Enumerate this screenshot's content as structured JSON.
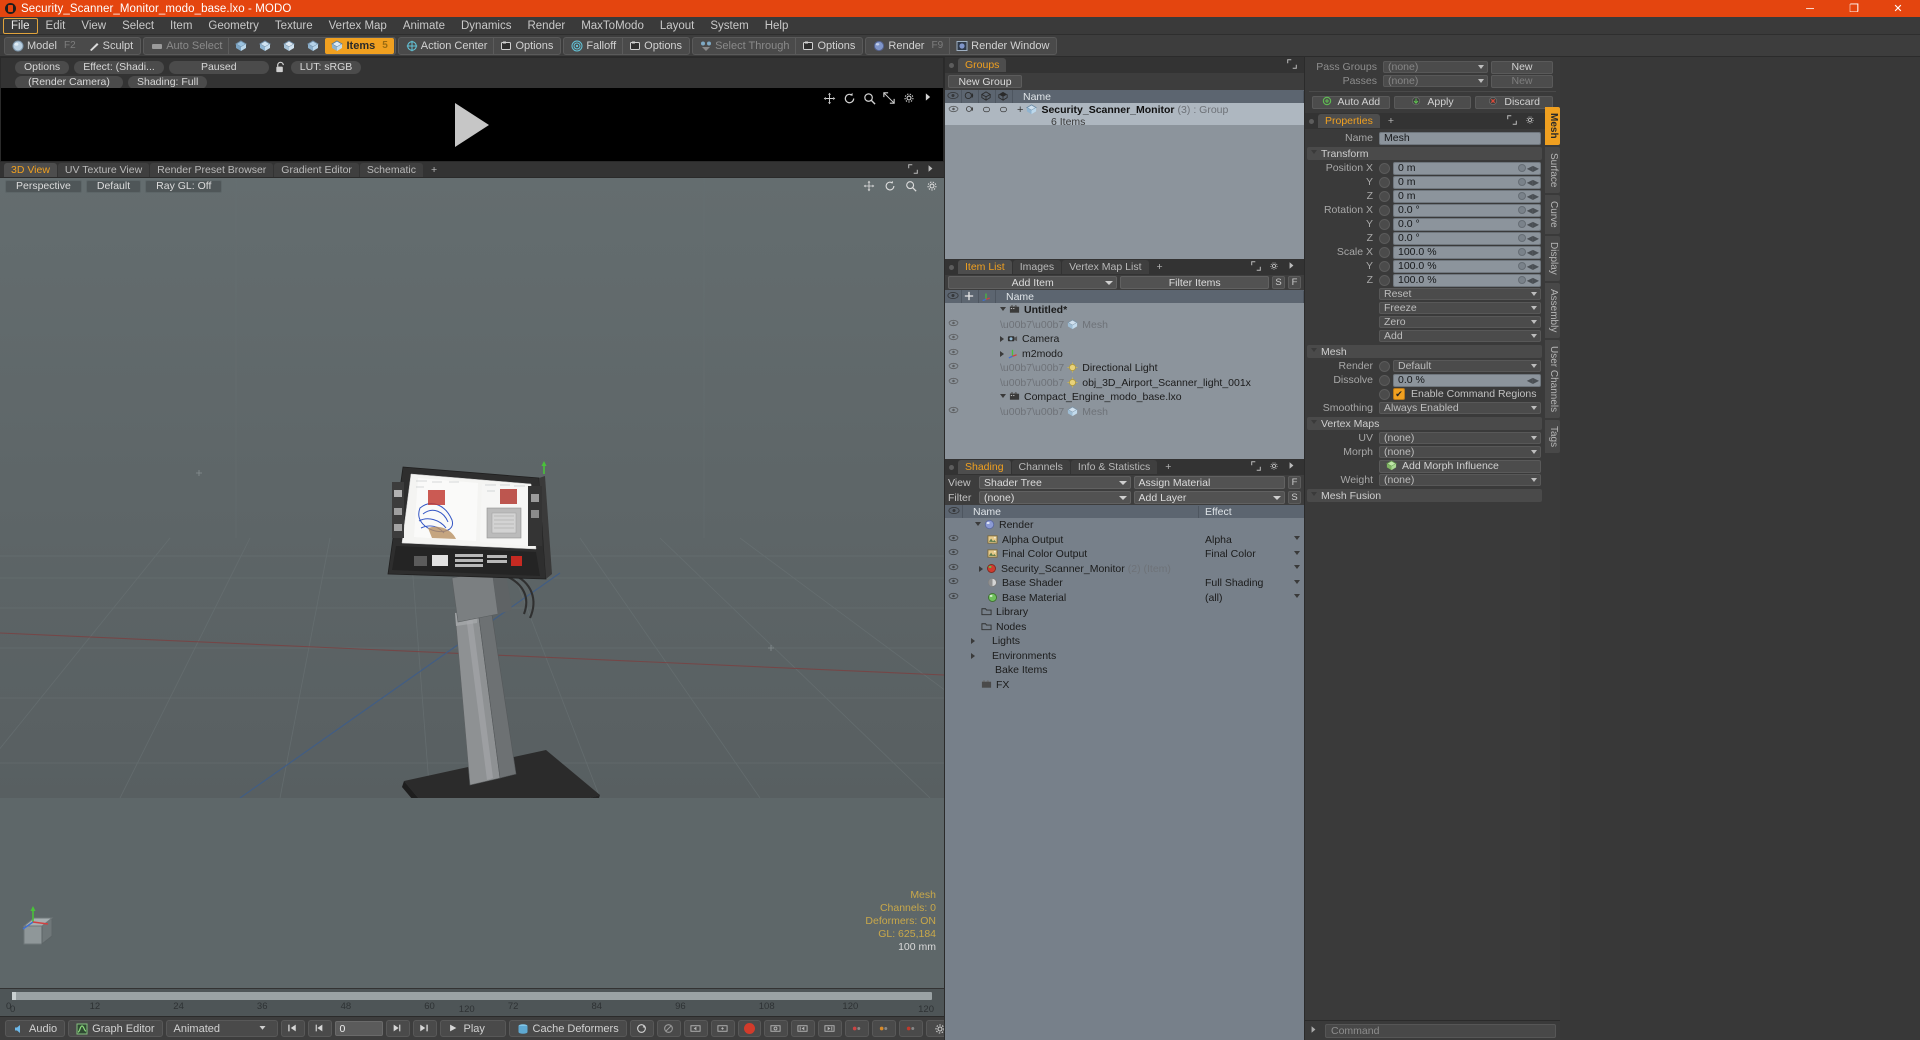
{
  "window": {
    "title": "Security_Scanner_Monitor_modo_base.lxo - MODO",
    "minimize": "─",
    "maximize": "❐",
    "close": "✕"
  },
  "menubar": {
    "items": [
      "File",
      "Edit",
      "View",
      "Select",
      "Item",
      "Geometry",
      "Texture",
      "Vertex Map",
      "Animate",
      "Dynamics",
      "Render",
      "MaxToModo",
      "Layout",
      "System",
      "Help"
    ],
    "active": "File"
  },
  "modebar": {
    "model": "Model",
    "model_key": "F2",
    "sculpt": "Sculpt",
    "auto_select": "Auto Select",
    "items": "Items",
    "items_key": "5",
    "action_center": "Action Center",
    "options1": "Options",
    "falloff": "Falloff",
    "options2": "Options",
    "select_through": "Select Through",
    "options3": "Options",
    "render": "Render",
    "render_key": "F9",
    "render_window": "Render Window"
  },
  "render_preview": {
    "options": "Options",
    "effect": "Effect: (Shadi...",
    "paused": "Paused",
    "lut": "LUT: sRGB",
    "camera": "(Render Camera)",
    "shading": "Shading: Full"
  },
  "viewport": {
    "tabs": [
      "3D View",
      "UV Texture View",
      "Render Preset Browser",
      "Gradient Editor",
      "Schematic"
    ],
    "selected_tab": "3D View",
    "add_tab": "+",
    "perspective": "Perspective",
    "default": "Default",
    "raygl": "Ray GL: Off",
    "stats": {
      "mesh": "Mesh",
      "channels": "Channels: 0",
      "deformers": "Deformers: ON",
      "gl": "GL: 625,184",
      "scale": "100 mm"
    }
  },
  "timeline": {
    "ticks": [
      "0",
      "12",
      "24",
      "36",
      "48",
      "60",
      "72",
      "84",
      "96",
      "108",
      "120"
    ],
    "left_end": "0",
    "center": "120",
    "right_end": "120"
  },
  "bottombar": {
    "audio": "Audio",
    "graph_editor": "Graph Editor",
    "animated": "Animated",
    "frame": "0",
    "play": "Play",
    "cache_deformers": "Cache Deformers",
    "settings": "Settings"
  },
  "groups_panel": {
    "title": "Groups",
    "new_group": "New Group",
    "column_name": "Name",
    "rows": [
      {
        "name": "Security_Scanner_Monitor",
        "count": "(3)",
        "type": ": Group",
        "sub": "6 Items"
      }
    ]
  },
  "item_list_panel": {
    "tabs": [
      "Item List",
      "Images",
      "Vertex Map List"
    ],
    "selected_tab": "Item List",
    "add_tab": "+",
    "add_item": "Add Item",
    "filter_items": "Filter Items",
    "s_button": "S",
    "f_button": "F",
    "column_name": "Name",
    "rows": [
      {
        "name": "Untitled*",
        "indent": 0,
        "icon": "scene-icon",
        "dim": false,
        "expanded": true
      },
      {
        "name": "Mesh",
        "indent": 2,
        "icon": "mesh-icon",
        "dim": true,
        "expanded": false
      },
      {
        "name": "Camera",
        "indent": 2,
        "icon": "camera-icon",
        "dim": false,
        "expanded": false
      },
      {
        "name": "m2modo",
        "indent": 2,
        "icon": "locator-icon",
        "dim": false,
        "expanded": false
      },
      {
        "name": "Directional Light",
        "indent": 2,
        "icon": "light-icon",
        "dim": false,
        "expanded": false
      },
      {
        "name": "obj_3D_Airport_Scanner_light_001x",
        "indent": 2,
        "icon": "light-icon",
        "dim": false,
        "expanded": false
      },
      {
        "name": "Compact_Engine_modo_base.lxo",
        "indent": 0,
        "icon": "scene-icon",
        "dim": false,
        "expanded": true
      },
      {
        "name": "Mesh",
        "indent": 2,
        "icon": "mesh-icon",
        "dim": true,
        "expanded": false
      }
    ]
  },
  "shading_panel": {
    "tabs": [
      "Shading",
      "Channels",
      "Info & Statistics"
    ],
    "selected_tab": "Shading",
    "add_tab": "+",
    "view_label": "View",
    "view_value": "Shader Tree",
    "assign_material": "Assign Material",
    "f_button": "F",
    "filter_label": "Filter",
    "filter_value": "(none)",
    "add_layer": "Add Layer",
    "s_button": "S",
    "column_name": "Name",
    "column_effect": "Effect",
    "rows": [
      {
        "name": "Render",
        "effect": "",
        "indent": 1,
        "icon": "render-globe-icon",
        "eye": false,
        "expander": "down"
      },
      {
        "name": "Alpha Output",
        "effect": "Alpha",
        "indent": 2,
        "icon": "image-output-icon",
        "eye": true,
        "expander": ""
      },
      {
        "name": "Final Color Output",
        "effect": "Final Color",
        "indent": 2,
        "icon": "image-output-icon",
        "eye": true,
        "expander": ""
      },
      {
        "name": "Security_Scanner_Monitor",
        "suffix": "(2) (Item)",
        "effect": "",
        "indent": 2,
        "icon": "material-red-icon",
        "eye": true,
        "expander": "right"
      },
      {
        "name": "Base Shader",
        "effect": "Full Shading",
        "indent": 2,
        "icon": "shader-icon",
        "eye": true,
        "expander": ""
      },
      {
        "name": "Base Material",
        "effect": "(all)",
        "indent": 2,
        "icon": "material-green-icon",
        "eye": true,
        "expander": ""
      },
      {
        "name": "Library",
        "effect": "",
        "indent": 1,
        "icon": "folder-icon",
        "eye": false,
        "expander": ""
      },
      {
        "name": "Nodes",
        "effect": "",
        "indent": 1,
        "icon": "folder-icon",
        "eye": false,
        "expander": ""
      },
      {
        "name": "Lights",
        "effect": "",
        "indent": 0,
        "icon": "",
        "eye": false,
        "expander": "right"
      },
      {
        "name": "Environments",
        "effect": "",
        "indent": 0,
        "icon": "",
        "eye": false,
        "expander": "right"
      },
      {
        "name": "Bake Items",
        "effect": "",
        "indent": 1,
        "icon": "",
        "eye": false,
        "expander": ""
      },
      {
        "name": "FX",
        "effect": "",
        "indent": 1,
        "icon": "fx-icon",
        "eye": false,
        "expander": ""
      }
    ]
  },
  "passes": {
    "pass_groups_label": "Pass Groups",
    "pass_groups_value": "(none)",
    "pass_groups_new": "New",
    "passes_label": "Passes",
    "passes_value": "(none)",
    "passes_new": "New",
    "auto_add": "Auto Add",
    "apply": "Apply",
    "discard": "Discard"
  },
  "properties": {
    "tab": "Properties",
    "add_tab": "+",
    "name_label": "Name",
    "name_value": "Mesh",
    "transform_section": "Transform",
    "transform": [
      {
        "label": "Position X",
        "value": "0 m"
      },
      {
        "label": "Y",
        "value": "0 m"
      },
      {
        "label": "Z",
        "value": "0 m"
      },
      {
        "label": "Rotation X",
        "value": "0.0 °"
      },
      {
        "label": "Y",
        "value": "0.0 °"
      },
      {
        "label": "Z",
        "value": "0.0 °"
      },
      {
        "label": "Scale X",
        "value": "100.0 %"
      },
      {
        "label": "Y",
        "value": "100.0 %"
      },
      {
        "label": "Z",
        "value": "100.0 %"
      }
    ],
    "transform_actions": [
      "Reset",
      "Freeze",
      "Zero",
      "Add"
    ],
    "mesh_section": "Mesh",
    "render_label": "Render",
    "render_value": "Default",
    "dissolve_label": "Dissolve",
    "dissolve_value": "0.0 %",
    "enable_command_regions": "Enable Command Regions",
    "smoothing_label": "Smoothing",
    "smoothing_value": "Always Enabled",
    "vertex_maps_section": "Vertex Maps",
    "uv_label": "UV",
    "uv_value": "(none)",
    "morph_label": "Morph",
    "morph_value": "(none)",
    "add_morph_influence": "Add Morph Influence",
    "weight_label": "Weight",
    "weight_value": "(none)",
    "mesh_fusion_section": "Mesh Fusion",
    "side_tabs": [
      "Mesh",
      "Surface",
      "Curve",
      "Display",
      "Assembly",
      "User Channels",
      "Tags"
    ],
    "side_tab_selected": "Mesh"
  },
  "command_bar": {
    "placeholder": "Command"
  },
  "colors": {
    "accent": "#f0a020",
    "title_bar": "#e4450f",
    "viewport_bg": "#5e6769",
    "panel_bg": "#3d3d3d",
    "list_bg": "#8c949c"
  }
}
